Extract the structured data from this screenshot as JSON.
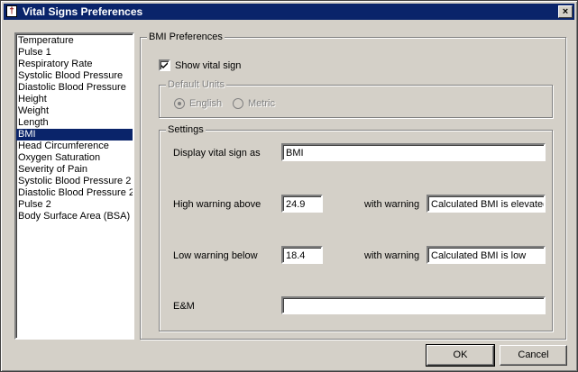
{
  "window": {
    "title": "Vital Signs Preferences",
    "icon": "caduceus-icon",
    "close_label": "×"
  },
  "vitals_list": {
    "items": [
      "Temperature",
      "Pulse 1",
      "Respiratory Rate",
      "Systolic Blood Pressure",
      "Diastolic Blood Pressure",
      "Height",
      "Weight",
      "Length",
      "BMI",
      "Head Circumference",
      "Oxygen Saturation",
      "Severity of Pain",
      "Systolic Blood Pressure 2",
      "Diastolic Blood Pressure 2",
      "Pulse 2",
      "Body Surface Area (BSA)"
    ],
    "selected": "BMI"
  },
  "preferences": {
    "group_title": "BMI Preferences",
    "show_vital_sign": {
      "label": "Show vital sign",
      "checked": true
    },
    "default_units": {
      "title": "Default Units",
      "options": [
        {
          "label": "English",
          "selected": true,
          "enabled": false
        },
        {
          "label": "Metric",
          "selected": false,
          "enabled": false
        }
      ]
    },
    "settings": {
      "title": "Settings",
      "display_label": "Display vital sign as",
      "display_value": "BMI",
      "high_label": "High warning above",
      "high_value": "24.9",
      "high_warning_label": "with warning",
      "high_warning_value": "Calculated BMI is elevated",
      "low_label": "Low warning below",
      "low_value": "18.4",
      "low_warning_label": "with warning",
      "low_warning_value": "Calculated BMI is low",
      "em_label": "E&M",
      "em_value": ""
    }
  },
  "buttons": {
    "ok": "OK",
    "cancel": "Cancel"
  }
}
